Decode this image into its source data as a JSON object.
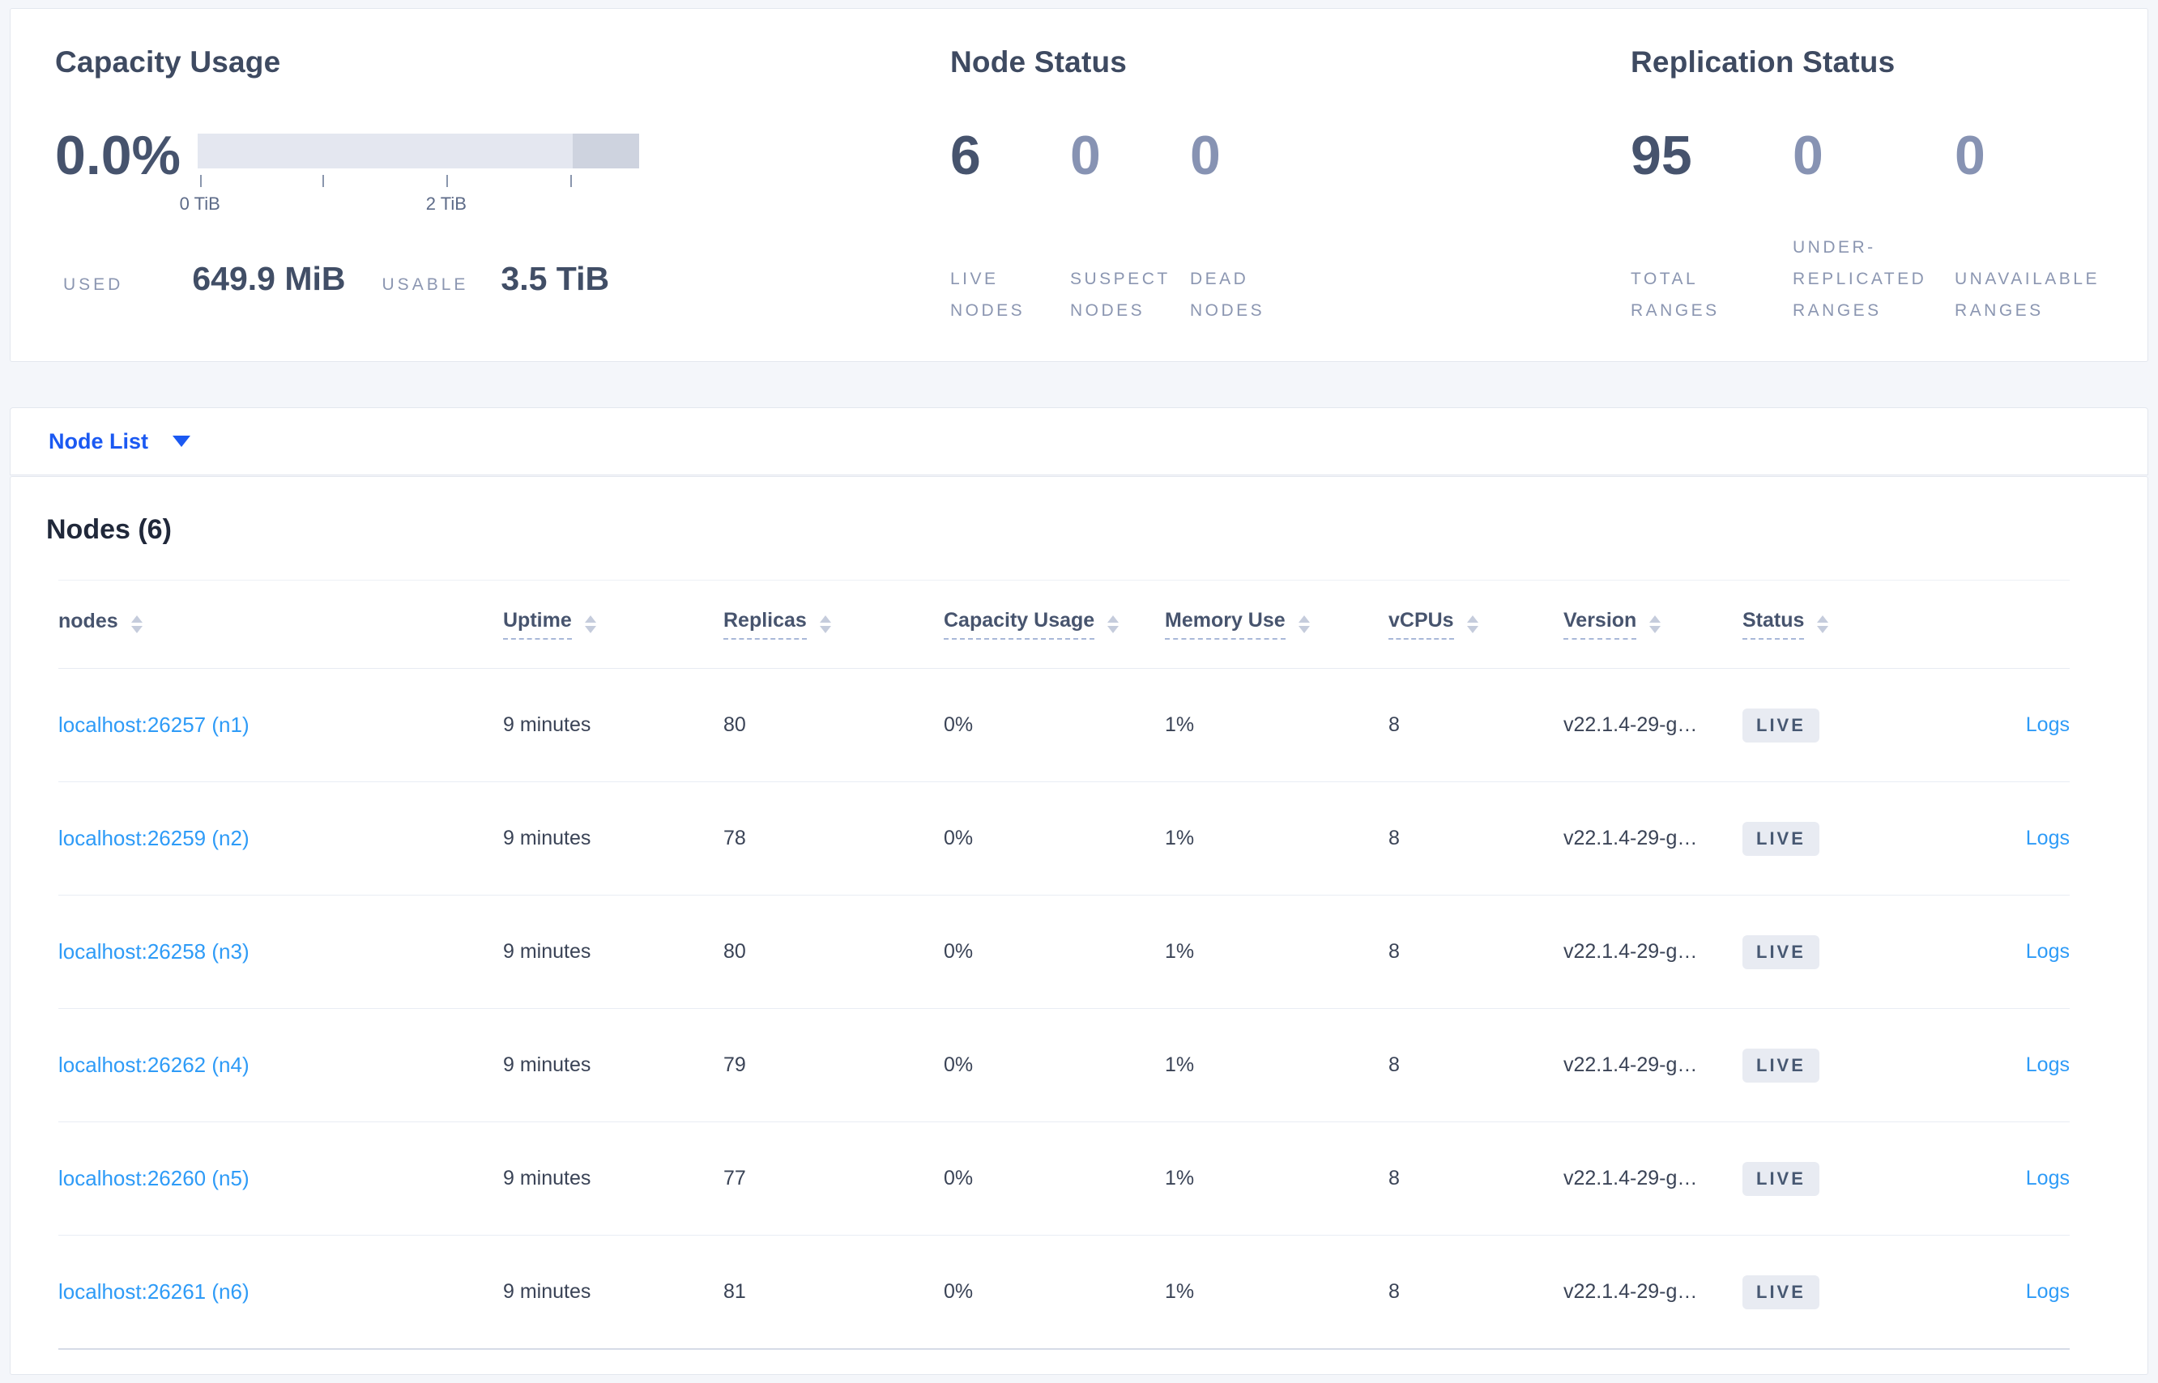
{
  "summary_card": {
    "capacity": {
      "title": "Capacity Usage",
      "percent": "0.0%",
      "used_label": "USED",
      "used_value": "649.9 MiB",
      "usable_label": "USABLE",
      "usable_value": "3.5 TiB",
      "chart": {
        "type": "bar",
        "ticks": [
          {
            "pos": 0.5,
            "label": "0 TiB"
          },
          {
            "pos": 28.2,
            "label": ""
          },
          {
            "pos": 56.3,
            "label": "2 TiB"
          },
          {
            "pos": 84.4,
            "label": ""
          }
        ],
        "segments": [
          {
            "name": "usable",
            "start": 0,
            "end": 85,
            "color": "#e4e7f0"
          },
          {
            "name": "other",
            "start": 85,
            "end": 100,
            "color": "#ced3df"
          }
        ]
      }
    },
    "node_status": {
      "title": "Node Status",
      "stats": [
        {
          "value": "6",
          "label": "LIVE NODES"
        },
        {
          "value": "0",
          "label": "SUSPECT NODES"
        },
        {
          "value": "0",
          "label": "DEAD NODES"
        }
      ]
    },
    "replication_status": {
      "title": "Replication Status",
      "stats": [
        {
          "value": "95",
          "label": "TOTAL RANGES"
        },
        {
          "value": "0",
          "label": "UNDER-REPLICATED RANGES"
        },
        {
          "value": "0",
          "label": "UNAVAILABLE RANGES"
        }
      ]
    }
  },
  "node_list_bar": {
    "label": "Node List",
    "caret_icon": "triangle-down"
  },
  "nodes_table": {
    "title": "Nodes (6)",
    "logs_label": "Logs",
    "columns": [
      {
        "label": "nodes"
      },
      {
        "label": "Uptime"
      },
      {
        "label": "Replicas"
      },
      {
        "label": "Capacity Usage"
      },
      {
        "label": "Memory Use"
      },
      {
        "label": "vCPUs"
      },
      {
        "label": "Version"
      },
      {
        "label": "Status"
      }
    ],
    "rows": [
      {
        "address": "localhost:26257 (n1)",
        "uptime": "9 minutes",
        "replicas": "80",
        "capacity_usage": "0%",
        "memory_use": "1%",
        "vcpus": "8",
        "version": "v22.1.4-29-g…",
        "status": "LIVE"
      },
      {
        "address": "localhost:26259 (n2)",
        "uptime": "9 minutes",
        "replicas": "78",
        "capacity_usage": "0%",
        "memory_use": "1%",
        "vcpus": "8",
        "version": "v22.1.4-29-g…",
        "status": "LIVE"
      },
      {
        "address": "localhost:26258 (n3)",
        "uptime": "9 minutes",
        "replicas": "80",
        "capacity_usage": "0%",
        "memory_use": "1%",
        "vcpus": "8",
        "version": "v22.1.4-29-g…",
        "status": "LIVE"
      },
      {
        "address": "localhost:26262 (n4)",
        "uptime": "9 minutes",
        "replicas": "79",
        "capacity_usage": "0%",
        "memory_use": "1%",
        "vcpus": "8",
        "version": "v22.1.4-29-g…",
        "status": "LIVE"
      },
      {
        "address": "localhost:26260 (n5)",
        "uptime": "9 minutes",
        "replicas": "77",
        "capacity_usage": "0%",
        "memory_use": "1%",
        "vcpus": "8",
        "version": "v22.1.4-29-g…",
        "status": "LIVE"
      },
      {
        "address": "localhost:26261 (n6)",
        "uptime": "9 minutes",
        "replicas": "81",
        "capacity_usage": "0%",
        "memory_use": "1%",
        "vcpus": "8",
        "version": "v22.1.4-29-g…",
        "status": "LIVE"
      }
    ]
  },
  "colors": {
    "page_background": "#f4f6fa",
    "link_blue": "#2e9bf7",
    "dropdown_blue": "#1b59f2",
    "strong_number": "#46536d",
    "muted_number": "#8793b3",
    "badge_background": "#e8ebf2",
    "bar_light": "#e4e7f0",
    "bar_dark": "#ced3df"
  }
}
